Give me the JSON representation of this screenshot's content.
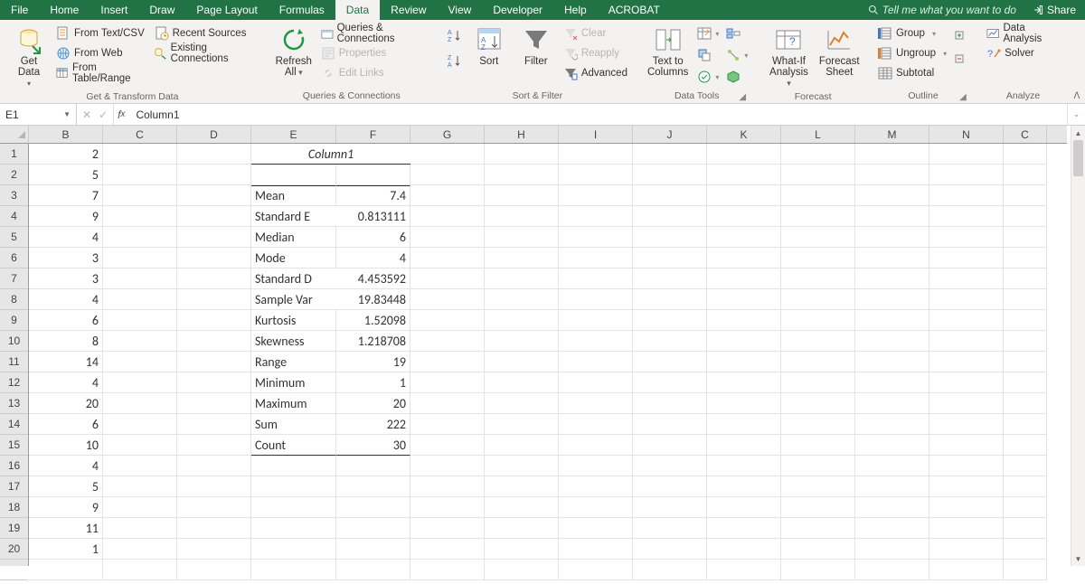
{
  "tabs": [
    "File",
    "Home",
    "Insert",
    "Draw",
    "Page Layout",
    "Formulas",
    "Data",
    "Review",
    "View",
    "Developer",
    "Help",
    "ACROBAT"
  ],
  "activeTab": "Data",
  "tellme": "Tell me what you want to do",
  "share": "Share",
  "groups": {
    "getdata": {
      "title": "Get & Transform Data",
      "getdata": "Get\nData",
      "items": [
        "From Text/CSV",
        "From Web",
        "From Table/Range",
        "Recent Sources",
        "Existing Connections"
      ]
    },
    "queries": {
      "title": "Queries & Connections",
      "refresh": "Refresh\nAll",
      "items": [
        "Queries & Connections",
        "Properties",
        "Edit Links"
      ]
    },
    "sort": {
      "title": "Sort & Filter",
      "sort": "Sort",
      "filter": "Filter",
      "items": [
        "Clear",
        "Reapply",
        "Advanced"
      ]
    },
    "tools": {
      "title": "Data Tools",
      "t2c": "Text to\nColumns"
    },
    "forecast": {
      "title": "Forecast",
      "whatif": "What-If\nAnalysis",
      "sheet": "Forecast\nSheet"
    },
    "outline": {
      "title": "Outline",
      "items": [
        "Group",
        "Ungroup",
        "Subtotal"
      ]
    },
    "analyze": {
      "title": "Analyze",
      "items": [
        "Data Analysis",
        "Solver"
      ]
    }
  },
  "namebox": "E1",
  "formula": "Column1",
  "colWidths": {
    "B": 82,
    "C": 82,
    "D": 82,
    "E": 94,
    "F": 82,
    "G": 82,
    "H": 82,
    "I": 82,
    "J": 82,
    "K": 82,
    "L": 82,
    "M": 82,
    "N": 82,
    "C2": 48
  },
  "cols": [
    "B",
    "C",
    "D",
    "E",
    "F",
    "G",
    "H",
    "I",
    "J",
    "K",
    "L",
    "M",
    "N",
    "C2"
  ],
  "colLabels": {
    "C2": "C"
  },
  "rows": 20,
  "dataB": [
    2,
    5,
    7,
    9,
    4,
    3,
    3,
    4,
    6,
    8,
    14,
    4,
    20,
    6,
    10,
    4,
    5,
    9,
    11,
    1
  ],
  "header": "Column1",
  "stats": [
    {
      "label": "Mean",
      "value": "7.4"
    },
    {
      "label": "Standard E",
      "value": "0.813111",
      "overflow": true
    },
    {
      "label": "Median",
      "value": "6"
    },
    {
      "label": "Mode",
      "value": "4"
    },
    {
      "label": "Standard D",
      "value": "4.453592",
      "overflow": true
    },
    {
      "label": "Sample Var",
      "value": "19.83448",
      "overflow": true
    },
    {
      "label": "Kurtosis",
      "value": "1.52098"
    },
    {
      "label": "Skewness",
      "value": "1.218708"
    },
    {
      "label": "Range",
      "value": "19"
    },
    {
      "label": "Minimum",
      "value": "1"
    },
    {
      "label": "Maximum",
      "value": "20"
    },
    {
      "label": "Sum",
      "value": "222"
    },
    {
      "label": "Count",
      "value": "30"
    }
  ]
}
